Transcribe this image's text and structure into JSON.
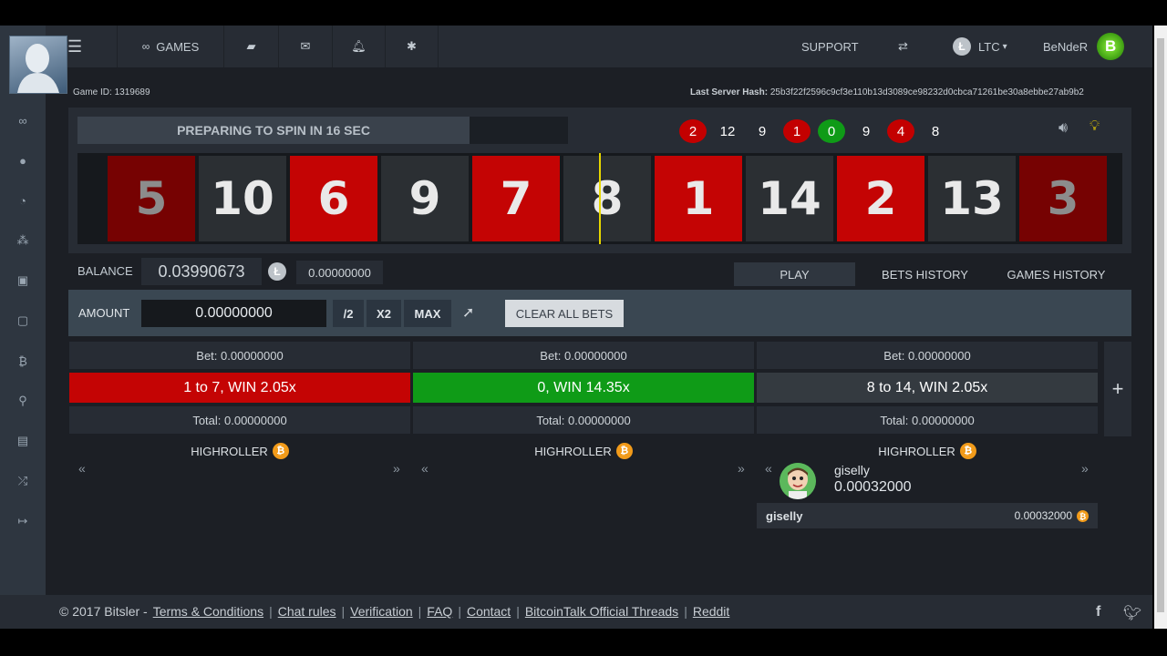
{
  "topbar": {
    "games_label": "GAMES",
    "support_label": "SUPPORT",
    "currency_label": "LTC",
    "username": "BeNdeR"
  },
  "info": {
    "game_id_label": "Game ID:",
    "game_id": "1319689",
    "server_hash_label": "Last Server Hash:",
    "server_hash": "25b3f22f2596c9cf3e110b13d3089ce98232d0cbca71261be30a8ebbe27ab9b2"
  },
  "wheel": {
    "status": "PREPARING TO SPIN IN 16 SEC",
    "history": [
      {
        "value": "2",
        "color": "red"
      },
      {
        "value": "12",
        "color": "black"
      },
      {
        "value": "9",
        "color": "black"
      },
      {
        "value": "1",
        "color": "red"
      },
      {
        "value": "0",
        "color": "green"
      },
      {
        "value": "9",
        "color": "black"
      },
      {
        "value": "4",
        "color": "red"
      },
      {
        "value": "8",
        "color": "black"
      }
    ],
    "tiles": [
      {
        "value": "5",
        "color": "red"
      },
      {
        "value": "10",
        "color": "black"
      },
      {
        "value": "6",
        "color": "red"
      },
      {
        "value": "9",
        "color": "black"
      },
      {
        "value": "7",
        "color": "red"
      },
      {
        "value": "8",
        "color": "black"
      },
      {
        "value": "1",
        "color": "red"
      },
      {
        "value": "14",
        "color": "black"
      },
      {
        "value": "2",
        "color": "red"
      },
      {
        "value": "13",
        "color": "black"
      },
      {
        "value": "3",
        "color": "red"
      }
    ]
  },
  "balance": {
    "label": "BALANCE",
    "value": "0.03990673",
    "secondary": "0.00000000"
  },
  "tabs": {
    "play": "PLAY",
    "bets_history": "BETS HISTORY",
    "games_history": "GAMES HISTORY"
  },
  "amount": {
    "label": "AMOUNT",
    "value": "0.00000000",
    "half": "/2",
    "double": "X2",
    "max": "MAX",
    "clear": "CLEAR ALL BETS"
  },
  "bets": [
    {
      "bet": "Bet: 0.00000000",
      "label": "1 to 7, WIN 2.05x",
      "total": "Total: 0.00000000",
      "color": "red"
    },
    {
      "bet": "Bet: 0.00000000",
      "label": "0, WIN 14.35x",
      "total": "Total: 0.00000000",
      "color": "green"
    },
    {
      "bet": "Bet: 0.00000000",
      "label": "8 to 14, WIN 2.05x",
      "total": "Total: 0.00000000",
      "color": "black"
    }
  ],
  "highroller": {
    "label": "HIGHROLLER",
    "player_name": "giselly",
    "player_amount": "0.00032000",
    "row_name": "giselly",
    "row_amount": "0.00032000"
  },
  "footer": {
    "copyright": "© 2017 Bitsler -",
    "links": [
      "Terms & Conditions",
      "Chat rules",
      "Verification",
      "FAQ",
      "Contact",
      "BitcoinTalk Official Threads",
      "Reddit"
    ]
  },
  "icons": {
    "sidebar": [
      "gamepad-icon",
      "user-icon",
      "pie-chart-icon",
      "users-icon",
      "inbox-icon",
      "picture-icon",
      "bitcoin-icon",
      "search-icon",
      "book-icon",
      "shuffle-icon",
      "sign-out-icon"
    ]
  },
  "colors": {
    "red": "#c40404",
    "green": "#0f9b17",
    "black": "#2b2f33",
    "accent_yellow": "#e7d700"
  }
}
